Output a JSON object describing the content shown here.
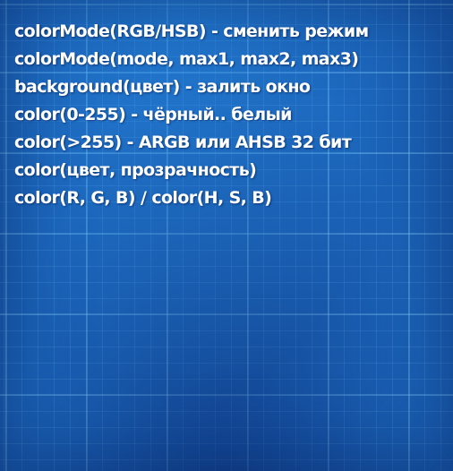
{
  "slide": {
    "lines": [
      "colorMode(RGB/HSB) - сменить режим",
      "colorMode(mode, max1, max2, max3)",
      "background(цвет) - залить окно",
      "color(0-255) - чёрный.. белый",
      "color(>255) - ARGB или AHSB 32 бит",
      "color(цвет, прозрачность)",
      "color(R, G, B) / color(H, S, B)"
    ]
  },
  "colors": {
    "background": "#1b63b8",
    "grid": "#78c8ff",
    "text": "#ffffff"
  }
}
